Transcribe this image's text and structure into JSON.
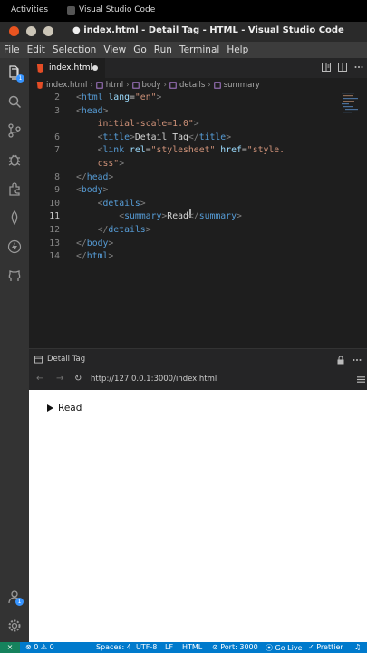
{
  "topbar": {
    "activities": "Activities",
    "app_name": "Visual Studio Code"
  },
  "window": {
    "title": "● index.html - Detail Tag - HTML - Visual Studio Code"
  },
  "menu": [
    "File",
    "Edit",
    "Selection",
    "View",
    "Go",
    "Run",
    "Terminal",
    "Help"
  ],
  "activity_badges": {
    "explorer": "1",
    "accounts": "1"
  },
  "tab": {
    "label": "index.html"
  },
  "breadcrumb": [
    "index.html",
    "html",
    "body",
    "details",
    "summary"
  ],
  "editor": {
    "current_line": "11",
    "lines": [
      {
        "n": "2",
        "tokens": [
          [
            "br",
            "<"
          ],
          [
            "tag",
            "html"
          ],
          [
            "txt",
            " "
          ],
          [
            "attr",
            "lang"
          ],
          [
            "txt",
            "="
          ],
          [
            "str",
            "\"en\""
          ],
          [
            "br",
            ">"
          ]
        ]
      },
      {
        "n": "3",
        "tokens": [
          [
            "br",
            "<"
          ],
          [
            "tag",
            "head"
          ],
          [
            "br",
            ">"
          ]
        ]
      },
      {
        "n": "",
        "tokens": [
          [
            "txt",
            "    "
          ],
          [
            "str",
            "initial-scale=1.0\""
          ],
          [
            "br",
            ">"
          ]
        ]
      },
      {
        "n": "6",
        "tokens": [
          [
            "txt",
            "    "
          ],
          [
            "br",
            "<"
          ],
          [
            "tag",
            "title"
          ],
          [
            "br",
            ">"
          ],
          [
            "txt",
            "Detail Tag"
          ],
          [
            "br",
            "</"
          ],
          [
            "tag",
            "title"
          ],
          [
            "br",
            ">"
          ]
        ]
      },
      {
        "n": "7",
        "tokens": [
          [
            "txt",
            "    "
          ],
          [
            "br",
            "<"
          ],
          [
            "tag",
            "link"
          ],
          [
            "txt",
            " "
          ],
          [
            "attr",
            "rel"
          ],
          [
            "txt",
            "="
          ],
          [
            "str",
            "\"stylesheet\""
          ],
          [
            "txt",
            " "
          ],
          [
            "attr",
            "href"
          ],
          [
            "txt",
            "="
          ],
          [
            "str",
            "\"style."
          ]
        ]
      },
      {
        "n": "",
        "tokens": [
          [
            "txt",
            "    "
          ],
          [
            "str",
            "css\""
          ],
          [
            "br",
            ">"
          ]
        ]
      },
      {
        "n": "8",
        "tokens": [
          [
            "br",
            "</"
          ],
          [
            "tag",
            "head"
          ],
          [
            "br",
            ">"
          ]
        ]
      },
      {
        "n": "9",
        "tokens": [
          [
            "br",
            "<"
          ],
          [
            "tag",
            "body"
          ],
          [
            "br",
            ">"
          ]
        ]
      },
      {
        "n": "10",
        "tokens": [
          [
            "txt",
            "    "
          ],
          [
            "br",
            "<"
          ],
          [
            "tag",
            "details"
          ],
          [
            "br",
            ">"
          ]
        ]
      },
      {
        "n": "11",
        "tokens": [
          [
            "txt",
            "        "
          ],
          [
            "br",
            "<"
          ],
          [
            "tag",
            "summary"
          ],
          [
            "br",
            ">"
          ],
          [
            "txt",
            "Read"
          ],
          [
            "br",
            "</"
          ],
          [
            "tag",
            "summary"
          ],
          [
            "br",
            ">"
          ]
        ]
      },
      {
        "n": "12",
        "tokens": [
          [
            "txt",
            "    "
          ],
          [
            "br",
            "</"
          ],
          [
            "tag",
            "details"
          ],
          [
            "br",
            ">"
          ]
        ]
      },
      {
        "n": "13",
        "tokens": [
          [
            "br",
            "</"
          ],
          [
            "tag",
            "body"
          ],
          [
            "br",
            ">"
          ]
        ]
      },
      {
        "n": "14",
        "tokens": [
          [
            "br",
            "</"
          ],
          [
            "tag",
            "html"
          ],
          [
            "br",
            ">"
          ]
        ]
      }
    ]
  },
  "preview": {
    "tab_label": "Detail Tag",
    "url": "http://127.0.0.1:3000/index.html",
    "summary_text": "Read"
  },
  "status": {
    "errors": "0",
    "warnings": "0",
    "spaces": "Spaces: 4",
    "encoding": "UTF-8",
    "eol": "LF",
    "language": "HTML",
    "port": "Port: 3000",
    "golive": "Go Live",
    "prettier": "Prettier"
  },
  "colors": {
    "status_bar": "#007acc",
    "accent": "#3794ff"
  }
}
